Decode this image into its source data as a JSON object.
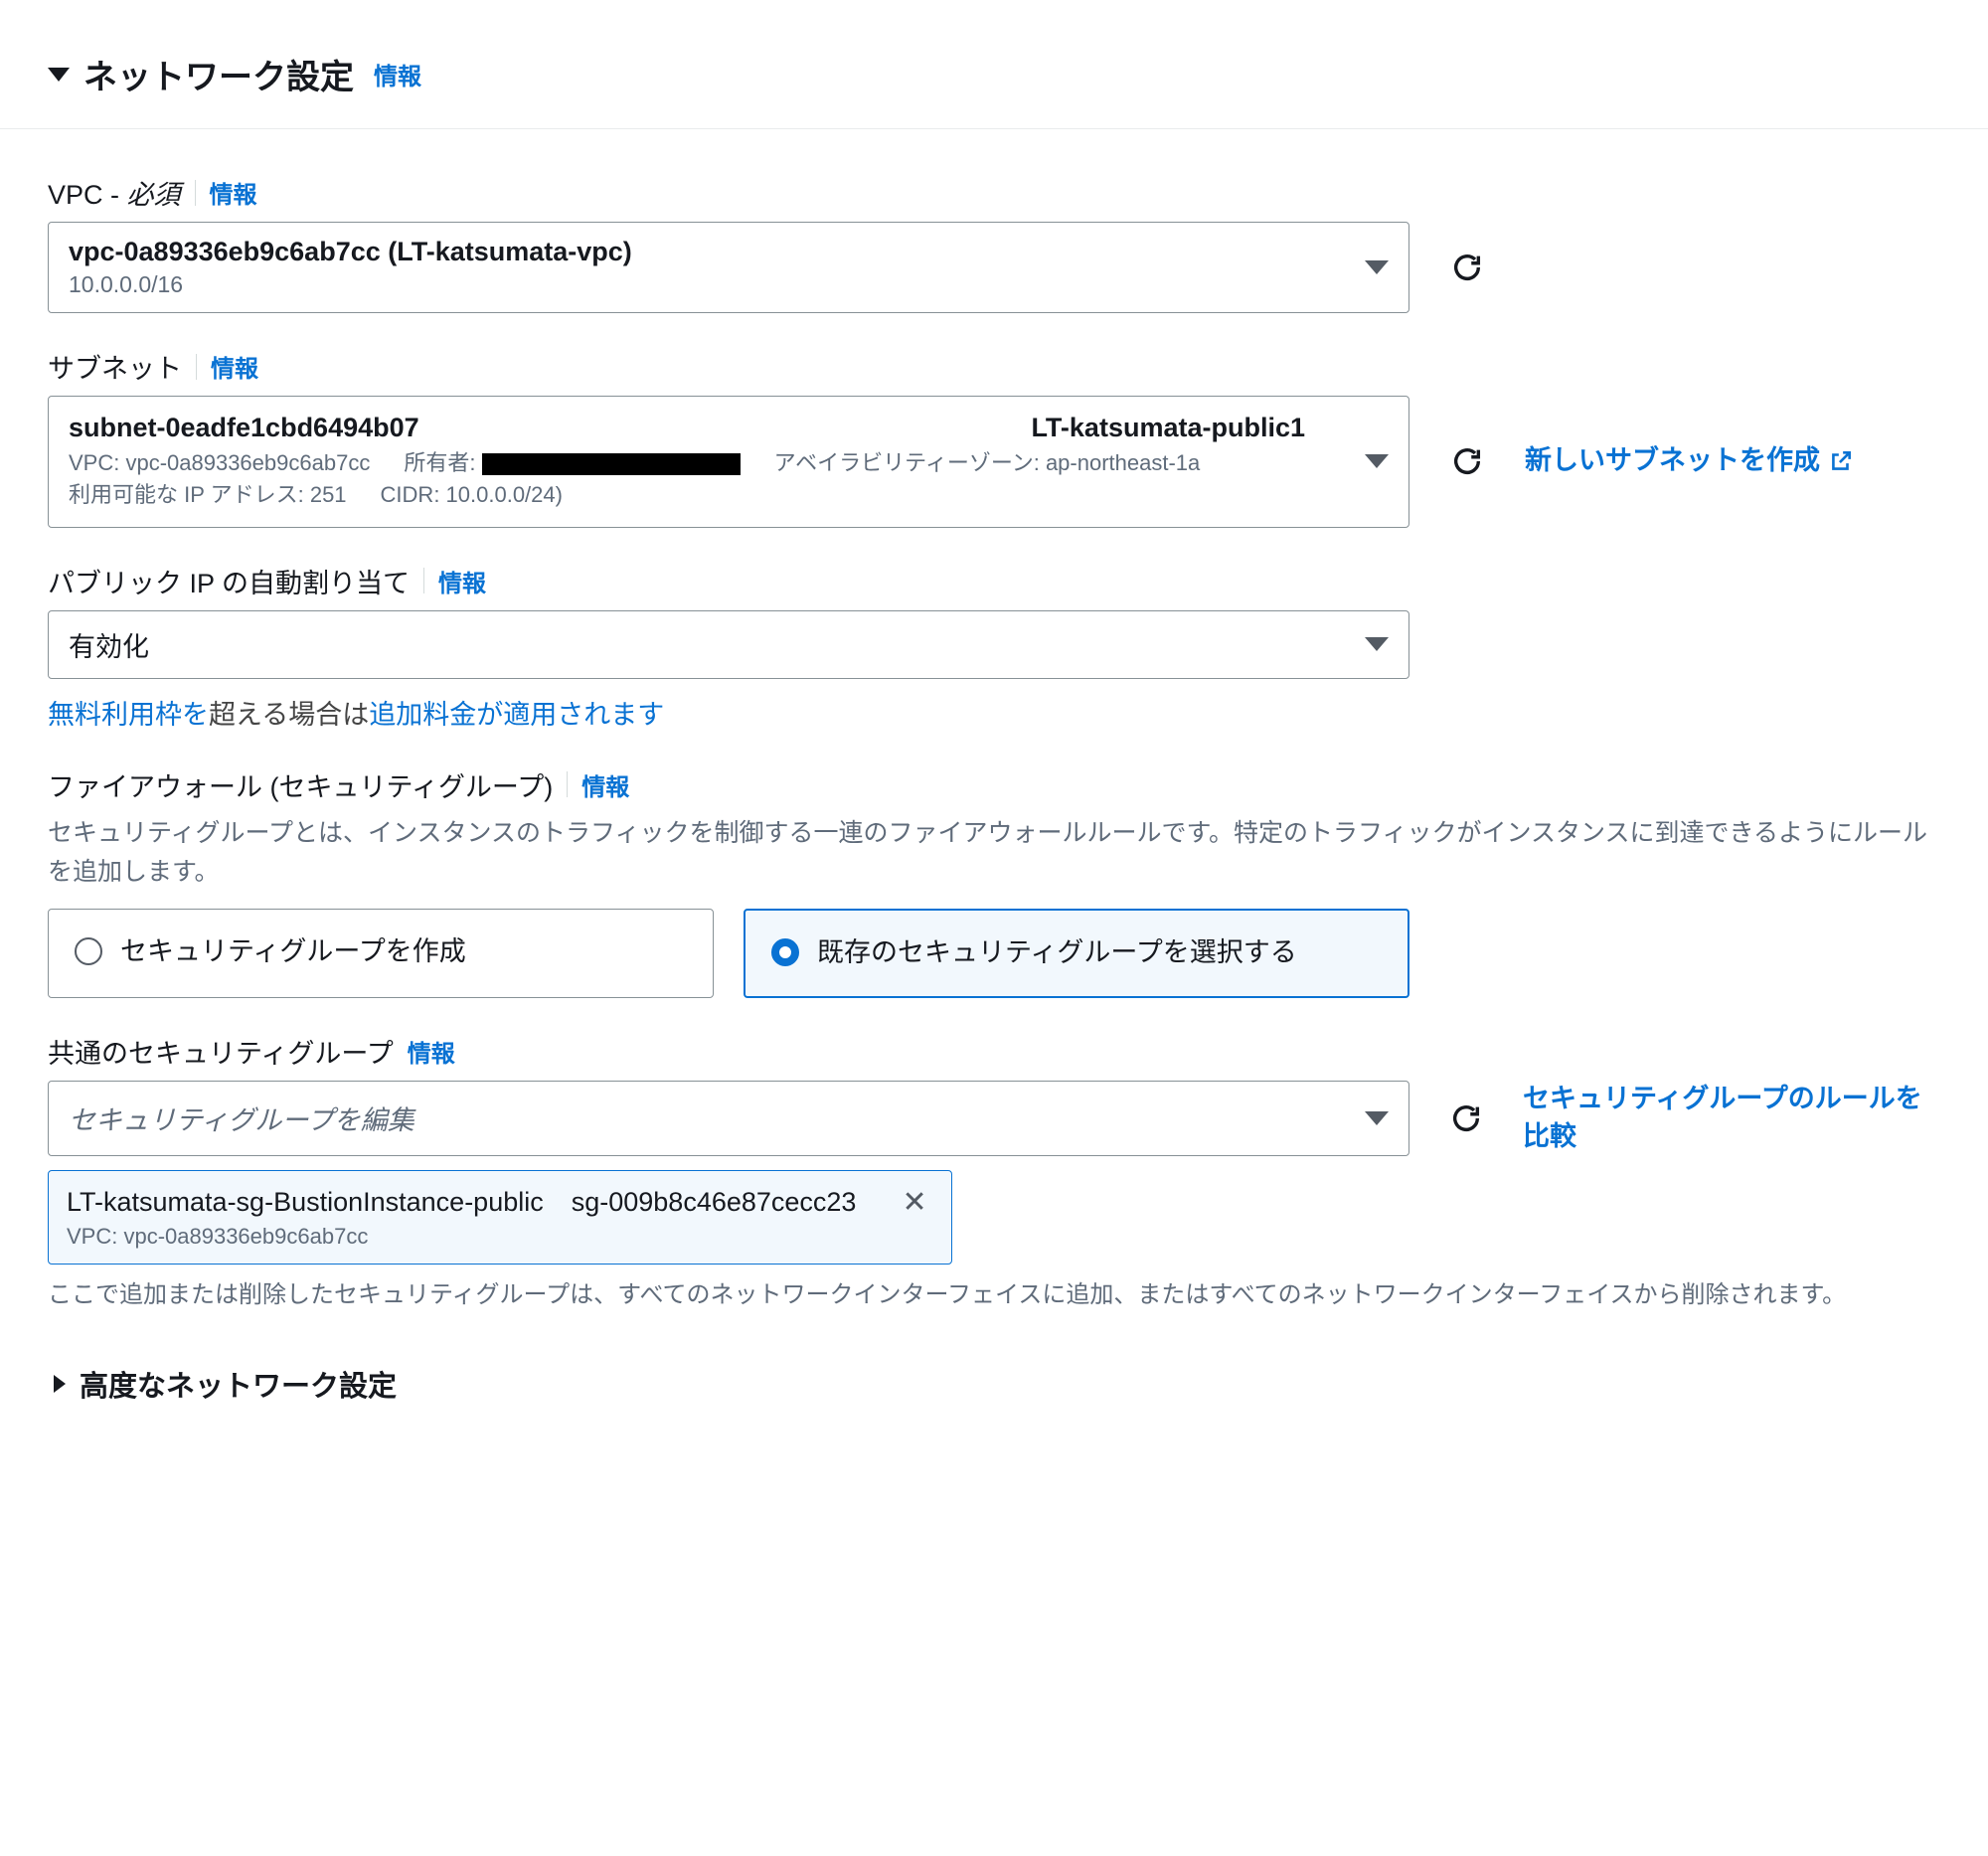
{
  "header": {
    "title": "ネットワーク設定",
    "info": "情報"
  },
  "vpc": {
    "label_prefix": "VPC - ",
    "label_required": "必須",
    "info": "情報",
    "value": "vpc-0a89336eb9c6ab7cc (LT-katsumata-vpc)",
    "cidr": "10.0.0.0/16"
  },
  "subnet": {
    "label": "サブネット",
    "info": "情報",
    "id": "subnet-0eadfe1cbd6494b07",
    "name": "LT-katsumata-public1",
    "vpc_line": "VPC: vpc-0a89336eb9c6ab7cc",
    "owner_label": "所有者:",
    "az_line": "アベイラビリティーゾーン: ap-northeast-1a",
    "ips_line": "利用可能な IP アドレス: 251",
    "cidr_line": "CIDR: 10.0.0.0/24)",
    "create_link": "新しいサブネットを作成"
  },
  "public_ip": {
    "label": "パブリック IP の自動割り当て",
    "info": "情報",
    "value": "有効化"
  },
  "notice": {
    "link1": "無料利用枠を",
    "mid": "超える場合は",
    "link2": "追加料金が適用されます"
  },
  "firewall": {
    "label": "ファイアウォール (セキュリティグループ)",
    "info": "情報",
    "desc": "セキュリティグループとは、インスタンスのトラフィックを制御する一連のファイアウォールルールです。特定のトラフィックがインスタンスに到達できるようにルールを追加します。",
    "opt_create": "セキュリティグループを作成",
    "opt_existing": "既存のセキュリティグループを選択する"
  },
  "common_sg": {
    "label": "共通のセキュリティグループ",
    "info": "情報",
    "placeholder": "セキュリティグループを編集",
    "chip_name": "LT-katsumata-sg-BustionInstance-public",
    "chip_id": "sg-009b8c46e87cecc23",
    "chip_sub": "VPC: vpc-0a89336eb9c6ab7cc",
    "help": "ここで追加または削除したセキュリティグループは、すべてのネットワークインターフェイスに追加、またはすべてのネットワークインターフェイスから削除されます。",
    "compare_link": "セキュリティグループのルールを比較"
  },
  "advanced": {
    "label": "高度なネットワーク設定"
  }
}
